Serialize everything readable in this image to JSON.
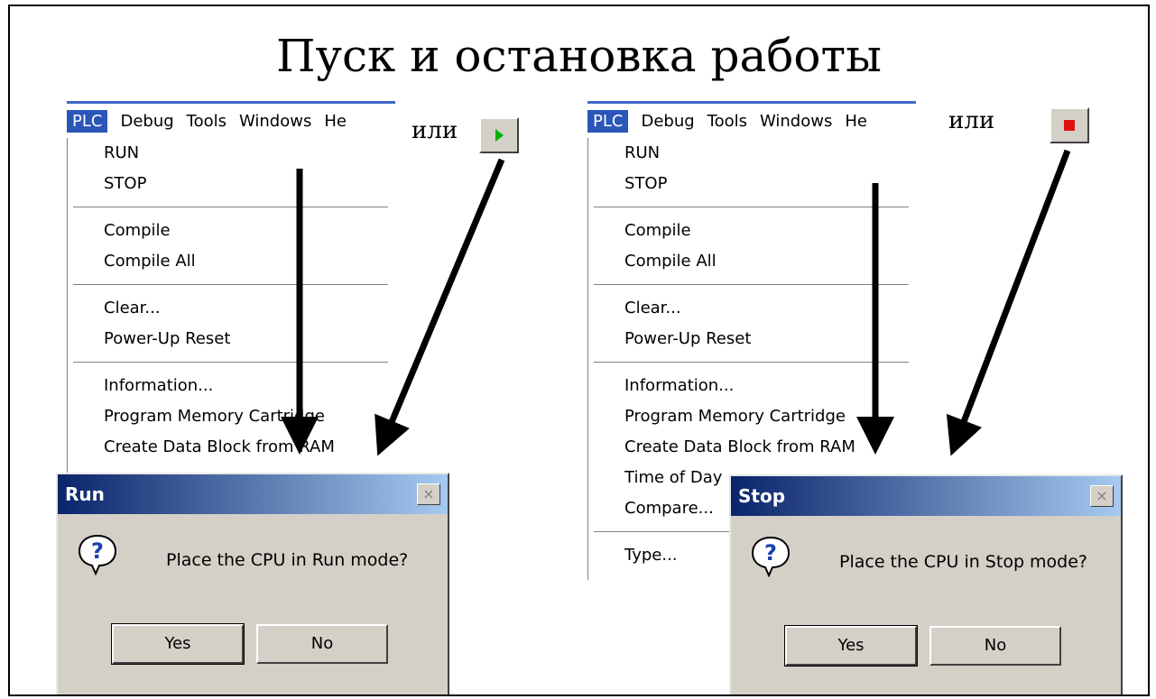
{
  "title": "Пуск и остановка работы",
  "or_label": "или",
  "left_menu": {
    "menubar": [
      "PLC",
      "Debug",
      "Tools",
      "Windows",
      "He"
    ],
    "items": [
      "RUN",
      "STOP",
      "Compile",
      "Compile All",
      "Clear...",
      "Power-Up Reset",
      "Information...",
      "Program Memory Cartridge",
      "Create Data Block from RAM"
    ]
  },
  "right_menu": {
    "menubar": [
      "PLC",
      "Debug",
      "Tools",
      "Windows",
      "He"
    ],
    "items": [
      "RUN",
      "STOP",
      "Compile",
      "Compile All",
      "Clear...",
      "Power-Up Reset",
      "Information...",
      "Program Memory Cartridge",
      "Create Data Block from RAM",
      "Time of Day",
      "Compare...",
      "Type..."
    ]
  },
  "run_toolbar_icon": "run-play-icon",
  "stop_toolbar_icon": "stop-square-icon",
  "run_dialog": {
    "title": "Run",
    "message": "Place the CPU in Run mode?",
    "close": "×",
    "yes": "Yes",
    "no": "No"
  },
  "stop_dialog": {
    "title": "Stop",
    "message": "Place the CPU in Stop mode?",
    "close": "×",
    "yes": "Yes",
    "no": "No"
  },
  "colors": {
    "menu_highlight": "#2a56b8",
    "play_green": "#00b000",
    "stop_red": "#e01010",
    "titlebar_start": "#0a246a",
    "titlebar_end": "#a6caf0"
  }
}
